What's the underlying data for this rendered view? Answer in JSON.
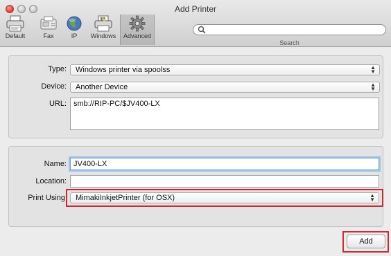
{
  "window": {
    "title": "Add Printer"
  },
  "toolbar": {
    "items": [
      {
        "label": "Default",
        "icon": "printer-icon"
      },
      {
        "label": "Fax",
        "icon": "fax-icon"
      },
      {
        "label": "IP",
        "icon": "globe-icon"
      },
      {
        "label": "Windows",
        "icon": "windows-printer-icon"
      },
      {
        "label": "Advanced",
        "icon": "gear-icon"
      }
    ],
    "selected": "Advanced",
    "search": {
      "placeholder": "",
      "label": "Search"
    }
  },
  "form": {
    "type": {
      "label": "Type:",
      "value": "Windows printer via spoolss"
    },
    "device": {
      "label": "Device:",
      "value": "Another Device"
    },
    "url": {
      "label": "URL:",
      "value": "smb://RIP-PC/$JV400-LX"
    },
    "name": {
      "label": "Name:",
      "value": "JV400-LX"
    },
    "location": {
      "label": "Location:",
      "value": ""
    },
    "print_using": {
      "label": "Print Using",
      "value": "MimakiInkjetPrinter (for OSX)"
    }
  },
  "buttons": {
    "add": "Add"
  },
  "colors": {
    "highlight": "#d6262e",
    "focus_ring": "#9cc3ef"
  }
}
